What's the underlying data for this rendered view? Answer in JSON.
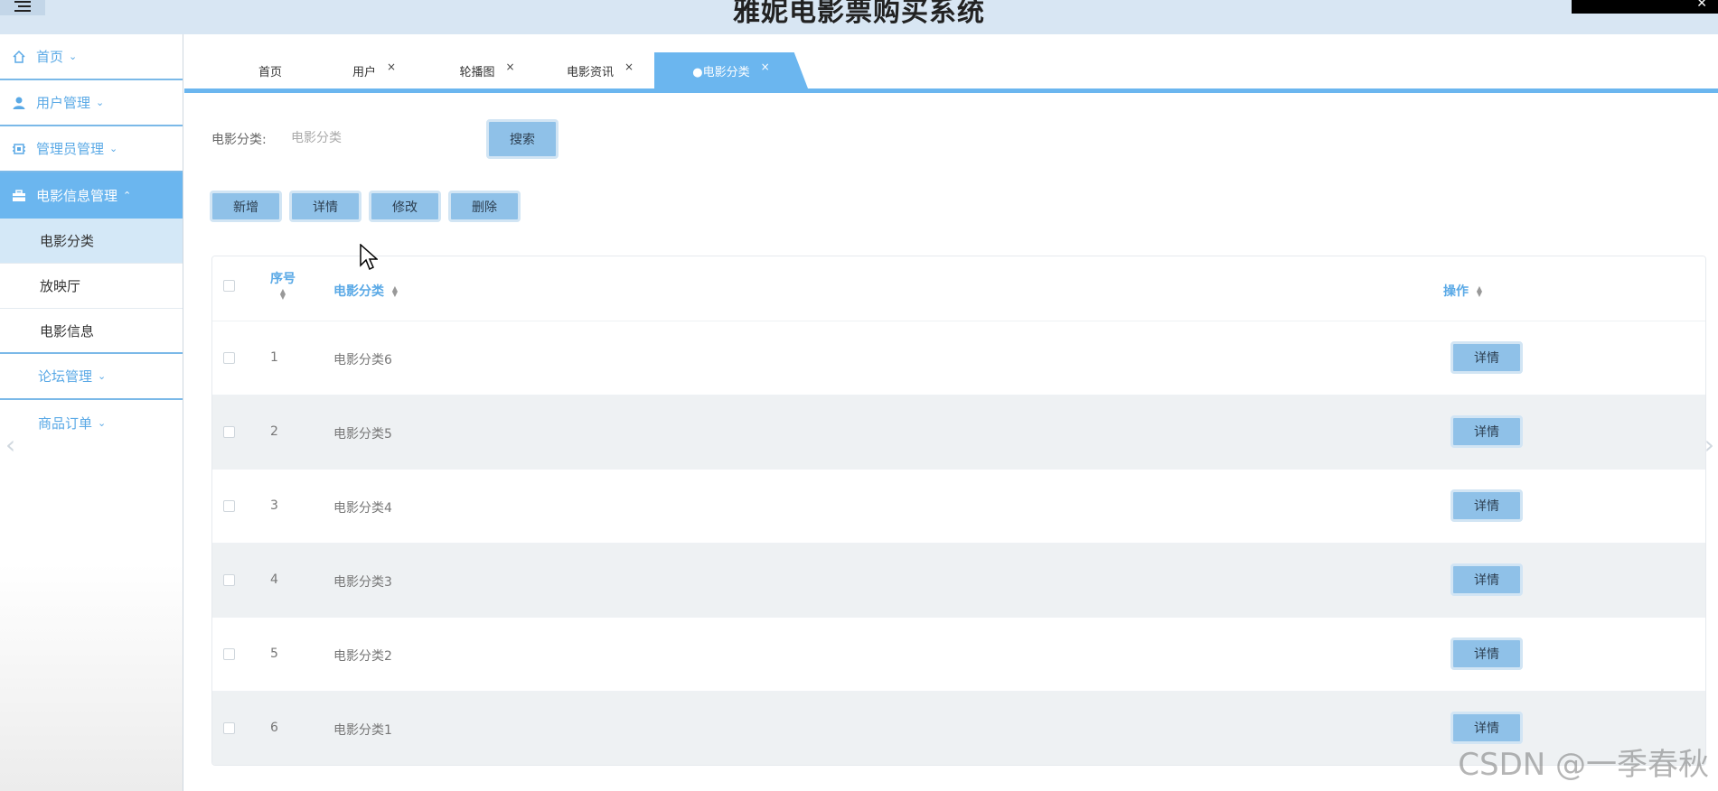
{
  "header": {
    "title": "雅妮电影票购买系统"
  },
  "sidebar": {
    "items": [
      {
        "label": "首页",
        "icon": "home-icon"
      },
      {
        "label": "用户管理",
        "icon": "user-icon"
      },
      {
        "label": "管理员管理",
        "icon": "chip-icon"
      },
      {
        "label": "电影信息管理",
        "icon": "briefcase-icon",
        "active": true
      },
      {
        "label": "论坛管理"
      },
      {
        "label": "商品订单"
      }
    ],
    "subitems": [
      "电影分类",
      "放映厅",
      "电影信息"
    ]
  },
  "tabs": [
    {
      "label": "首页"
    },
    {
      "label": "用户",
      "close": "×"
    },
    {
      "label": "轮播图",
      "close": "×"
    },
    {
      "label": "电影资讯",
      "close": "×"
    },
    {
      "label": "●电影分类",
      "close": "×",
      "active": true
    }
  ],
  "search": {
    "label": "电影分类:",
    "placeholder": "电影分类",
    "button": "搜索"
  },
  "actions": {
    "add": "新增",
    "detail": "详情",
    "edit": "修改",
    "delete": "删除"
  },
  "table": {
    "headers": {
      "index": "序号",
      "category": "电影分类",
      "operation": "操作"
    },
    "rows": [
      {
        "index": "1",
        "category": "电影分类6",
        "action": "详情"
      },
      {
        "index": "2",
        "category": "电影分类5",
        "action": "详情"
      },
      {
        "index": "3",
        "category": "电影分类4",
        "action": "详情"
      },
      {
        "index": "4",
        "category": "电影分类3",
        "action": "详情"
      },
      {
        "index": "5",
        "category": "电影分类2",
        "action": "详情"
      },
      {
        "index": "6",
        "category": "电影分类1",
        "action": "详情"
      }
    ]
  },
  "watermark": "CSDN @一季春秋",
  "colors": {
    "accent": "#6bb6ef",
    "button": "#8fc1e8",
    "header_bg": "#d8e6f3"
  }
}
